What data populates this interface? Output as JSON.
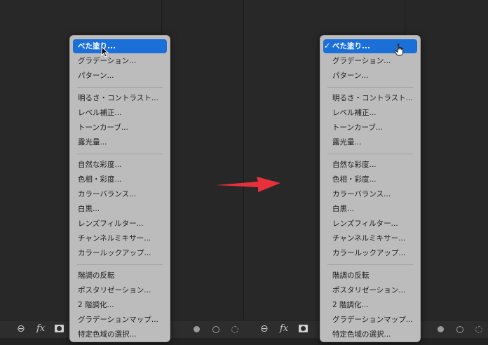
{
  "menu": {
    "items": [
      {
        "label": "べた塗り..."
      },
      {
        "label": "グラデーション..."
      },
      {
        "label": "パターン..."
      },
      {
        "label": "明るさ・コントラスト..."
      },
      {
        "label": "レベル補正..."
      },
      {
        "label": "トーンカーブ..."
      },
      {
        "label": "露光量..."
      },
      {
        "label": "自然な彩度..."
      },
      {
        "label": "色相・彩度..."
      },
      {
        "label": "カラーバランス..."
      },
      {
        "label": "白黒..."
      },
      {
        "label": "レンズフィルター..."
      },
      {
        "label": "チャンネルミキサー..."
      },
      {
        "label": "カラールックアップ..."
      },
      {
        "label": "階調の反転"
      },
      {
        "label": "ポスタリゼーション..."
      },
      {
        "label": "2 階調化..."
      },
      {
        "label": "グラデーションマップ..."
      },
      {
        "label": "特定色域の選択..."
      }
    ],
    "checkmark": "✓"
  },
  "toolbar": {
    "link_glyph": "⊖",
    "fx_label": "fx"
  },
  "colors": {
    "highlight": "#1a6fd8",
    "arrow": "#e8303c",
    "menu_bg": "#bcbcbc"
  },
  "icons": [
    "link-icon",
    "fx-icon",
    "mask-icon",
    "pointer-cursor-icon",
    "hand-cursor-icon",
    "arrow-icon"
  ]
}
